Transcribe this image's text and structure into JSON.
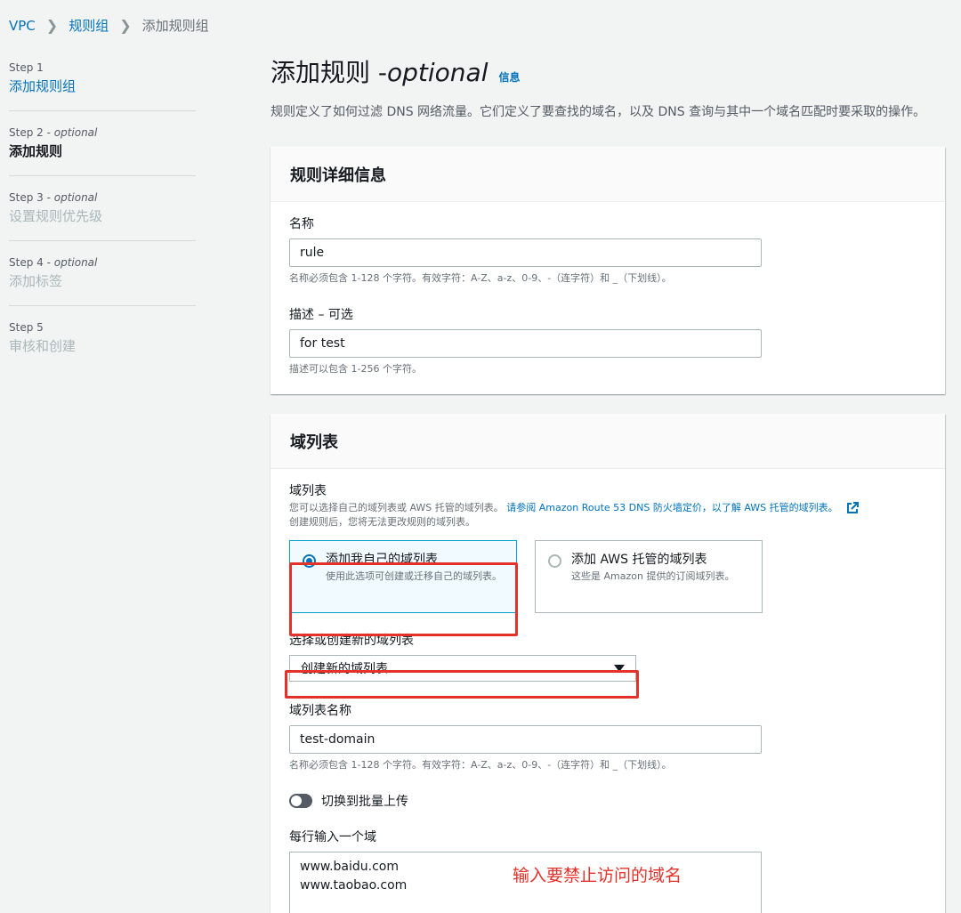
{
  "breadcrumb": {
    "vpc": "VPC",
    "rule_groups": "规则组",
    "current": "添加规则组"
  },
  "steps": [
    {
      "num": "Step 1",
      "optional": "",
      "title": "添加规则组",
      "state": "link"
    },
    {
      "num": "Step 2 - ",
      "optional": "optional",
      "title": "添加规则",
      "state": "active"
    },
    {
      "num": "Step 3 - ",
      "optional": "optional",
      "title": "设置规则优先级",
      "state": "disabled"
    },
    {
      "num": "Step 4 - ",
      "optional": "optional",
      "title": "添加标签",
      "state": "disabled"
    },
    {
      "num": "Step 5",
      "optional": "",
      "title": "审核和创建",
      "state": "disabled"
    }
  ],
  "page": {
    "title": "添加规则 - ",
    "title_optional": "optional",
    "info": "信息",
    "description": "规则定义了如何过滤 DNS 网络流量。它们定义了要查找的域名，以及 DNS 查询与其中一个域名匹配时要采取的操作。"
  },
  "rule_details": {
    "header": "规则详细信息",
    "name_label": "名称",
    "name_value": "rule",
    "name_hint": "名称必须包含 1-128 个字符。有效字符：A-Z、a-z、0-9、-（连字符）和 _（下划线）。",
    "desc_label": "描述 – 可选",
    "desc_value": "for test",
    "desc_hint": "描述可以包含 1-256 个字符。"
  },
  "domain_list": {
    "header": "域列表",
    "label": "域列表",
    "hint_text": "您可以选择自己的域列表或 AWS 托管的域列表。",
    "hint_link": "请参阅 Amazon Route 53 DNS 防火墙定价，以了解 AWS 托管的域列表。",
    "hint_line2": "创建规则后，您将无法更改规则的域列表。",
    "option_own_title": "添加我自己的域列表",
    "option_own_desc": "使用此选项可创建或迁移自己的域列表。",
    "option_aws_title": "添加 AWS 托管的域列表",
    "option_aws_desc": "这些是 Amazon 提供的订阅域列表。",
    "select_label": "选择或创建新的域列表",
    "select_value": "创建新的域列表",
    "list_name_label": "域列表名称",
    "list_name_value": "test-domain",
    "list_name_hint": "名称必须包含 1-128 个字符。有效字符：A-Z、a-z、0-9、-（连字符）和 _（下划线）。",
    "toggle_label": "切换到批量上传",
    "domains_label": "每行输入一个域",
    "domains": [
      "www.baidu.com",
      "www.taobao.com"
    ],
    "annotation": "输入要禁止访问的域名"
  },
  "colors": {
    "link": "#0073bb",
    "annotation_red": "#e4322b",
    "selected_tile": "#f1faff"
  }
}
